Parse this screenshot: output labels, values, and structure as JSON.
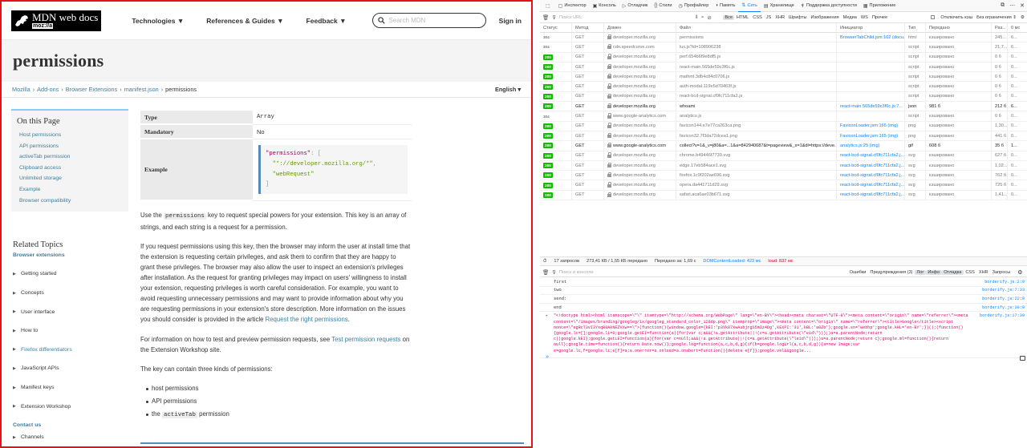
{
  "mdn": {
    "logo": {
      "main": "MDN web docs",
      "sub": "moz://a"
    },
    "nav": [
      "Technologies ▼",
      "References & Guides ▼",
      "Feedback ▼"
    ],
    "search_placeholder": "Search MDN",
    "signin": "Sign in",
    "title": "permissions",
    "breadcrumb": {
      "items": [
        "Mozilla",
        "Add-ons",
        "Browser Extensions",
        "manifest.json"
      ],
      "current": "permissions",
      "separator": "›",
      "language": "English ▾"
    },
    "on_this_page": {
      "heading": "On this Page",
      "links": [
        "Host permissions",
        "API permissions",
        "activeTab permission",
        "Clipboard access",
        "Unlimited storage",
        "Example",
        "Browser compatibility"
      ]
    },
    "related": {
      "heading": "Related Topics",
      "subheading": "Browser extensions",
      "items": [
        {
          "label": "Getting started",
          "link": false
        },
        {
          "label": "Concepts",
          "link": false
        },
        {
          "label": "User interface",
          "link": false
        },
        {
          "label": "How to",
          "link": false
        },
        {
          "label": "Firefox differentiators",
          "link": true
        },
        {
          "label": "JavaScript APIs",
          "link": false
        },
        {
          "label": "Manifest keys",
          "link": false
        },
        {
          "label": "Extension Workshop",
          "link": false
        }
      ],
      "contact": "Contact us",
      "items_after_contact": [
        {
          "label": "Channels",
          "link": false
        }
      ]
    },
    "table": {
      "type_label": "Type",
      "type_value": "Array",
      "mandatory_label": "Mandatory",
      "mandatory_value": "No",
      "example_label": "Example",
      "code": {
        "key": "\"permissions\"",
        "colon_bracket": ": [",
        "line2": "\"*://developer.mozilla.org/*\"",
        "line2_comma": ",",
        "line3": "\"webRequest\"",
        "close": "]"
      }
    },
    "prose": {
      "p1_a": "Use the ",
      "p1_code": "permissions",
      "p1_b": " key to request special powers for your extension. This key is an array of strings, and each string is a request for a permission.",
      "p2_a": "If you request permissions using this key, then the browser may inform the user at install time that the extension is requesting certain privileges, and ask them to confirm that they are happy to grant these privileges. The browser may also allow the user to inspect an extension's privileges after installation. As the request for granting privileges may impact on users' willingness to install your extension, requesting privileges is worth careful consideration. For example, you want to avoid requesting unnecessary permissions and may want to provide information about why you are requesting permissions in your extension's store description. More information on the issues you should consider is provided in the article ",
      "p2_link": "Request the right permissions",
      "p2_b": ".",
      "p3_a": "For information on how to test and preview permission requests, see ",
      "p3_link": "Test permission requests",
      "p3_b": " on the Extension Workshop site.",
      "p4": "The key can contain three kinds of permissions:",
      "list": [
        "host permissions",
        "API permissions"
      ],
      "list3_a": "the ",
      "list3_code": "activeTab",
      "list3_b": " permission"
    },
    "colors": {
      "link": "#3d7e9a",
      "frame": "#e4131b",
      "accent": "#83d0f2"
    }
  },
  "devtools": {
    "tabs": [
      {
        "icon": "▢",
        "label": "Инспектор",
        "active": false
      },
      {
        "icon": "▣",
        "label": "Консоль",
        "active": false
      },
      {
        "icon": "▷",
        "label": "Отладчик",
        "active": false
      },
      {
        "icon": "{}",
        "label": "Стили",
        "active": false
      },
      {
        "icon": "◷",
        "label": "Профайлер",
        "active": false
      },
      {
        "icon": "◑",
        "label": "Память",
        "active": false
      },
      {
        "icon": "⇅",
        "label": "Сеть",
        "active": true
      },
      {
        "icon": "▤",
        "label": "Хранилище",
        "active": false
      },
      {
        "icon": "✝",
        "label": "Поддержка доступности",
        "active": false
      },
      {
        "icon": "▦",
        "label": "Приложение",
        "active": false
      }
    ],
    "filter_placeholder": "Поиск URL",
    "filter_types": [
      "Все",
      "HTML",
      "CSS",
      "JS",
      "XHR",
      "Шрифты",
      "Изображения",
      "Медиа",
      "WS",
      "Прочее"
    ],
    "filter_active": "Все",
    "opts": {
      "cache": "Отключить кэш",
      "throttle": "Без ограничения ⇕"
    },
    "columns": [
      "Статус",
      "Метод",
      "Домен",
      "Файл",
      "Инициатор",
      "Тип",
      "Передано",
      "Раз...",
      "0 мс"
    ],
    "rows": [
      {
        "status": "304",
        "method": "GET",
        "domain": "developer.mozilla.org",
        "file": "permissions",
        "initiator": "BrowserTabChild.jsm:102 (docu...",
        "type": "html",
        "transferred": "кэшировано",
        "size": "245...",
        "time": "6...",
        "ok": false,
        "dark": false,
        "lock": true
      },
      {
        "status": "304",
        "method": "GET",
        "domain": "cdn.speedcurve.com",
        "file": "lux.js?id=108906238",
        "initiator": "",
        "type": "script",
        "transferred": "кэшировано",
        "size": "21,7...",
        "time": "6...",
        "ok": false,
        "dark": false,
        "lock": true
      },
      {
        "status": "200",
        "method": "GET",
        "domain": "developer.mozilla.org",
        "file": "perf.654b6f9e8df5.js",
        "initiator": "",
        "type": "script",
        "transferred": "кэшировано",
        "size": "0 б",
        "time": "0...",
        "ok": true,
        "dark": false,
        "lock": true
      },
      {
        "status": "200",
        "method": "GET",
        "domain": "developer.mozilla.org",
        "file": "react-main.565de59c3f6c.js",
        "initiator": "",
        "type": "script",
        "transferred": "кэшировано",
        "size": "0 б",
        "time": "0...",
        "ok": true,
        "dark": false,
        "lock": true
      },
      {
        "status": "200",
        "method": "GET",
        "domain": "developer.mozilla.org",
        "file": "mathml.3db4c84c0706.js",
        "initiator": "",
        "type": "script",
        "transferred": "кэшировано",
        "size": "0 б",
        "time": "0...",
        "ok": true,
        "dark": false,
        "lock": true
      },
      {
        "status": "200",
        "method": "GET",
        "domain": "developer.mozilla.org",
        "file": "auth-modal.119e5d70463f.js",
        "initiator": "",
        "type": "script",
        "transferred": "кэшировано",
        "size": "0 б",
        "time": "0...",
        "ok": true,
        "dark": false,
        "lock": true
      },
      {
        "status": "200",
        "method": "GET",
        "domain": "developer.mozilla.org",
        "file": "react-bcd-signal.cf0fc711cfa2.js",
        "initiator": "",
        "type": "script",
        "transferred": "кэшировано",
        "size": "0 б",
        "time": "0...",
        "ok": true,
        "dark": false,
        "lock": true
      },
      {
        "status": "200",
        "method": "GET",
        "domain": "developer.mozilla.org",
        "file": "whoami",
        "initiator": "react-main.565de59c3f6c.js:7...",
        "type": "json",
        "transferred": "981 б",
        "size": "212 б",
        "time": "6...",
        "ok": true,
        "dark": true,
        "lock": true
      },
      {
        "status": "304",
        "method": "GET",
        "domain": "www.google-analytics.com",
        "file": "analytics.js",
        "initiator": "",
        "type": "script",
        "transferred": "кэшировано",
        "size": "0 б",
        "time": "0...",
        "ok": false,
        "dark": false,
        "lock": true
      },
      {
        "status": "200",
        "method": "GET",
        "domain": "developer.mozilla.org",
        "file": "favicon144.e7e77ca263ca.png",
        "initiator": "FaviconLoader.jsm:165 (img)",
        "type": "png",
        "transferred": "кэшировано",
        "size": "1,30...",
        "time": "0...",
        "ok": true,
        "dark": false,
        "lock": true
      },
      {
        "status": "200",
        "method": "GET",
        "domain": "developer.mozilla.org",
        "file": "favicon32.7f3da72dcea1.png",
        "initiator": "FaviconLoader.jsm:165 (img)",
        "type": "png",
        "transferred": "кэшировано",
        "size": "441 б",
        "time": "0...",
        "ok": true,
        "dark": false,
        "lock": true
      },
      {
        "status": "200",
        "method": "GET",
        "domain": "www.google-analytics.com",
        "file": "collect?v=1&_v=j80&a=...1&a=842940687&t=pageview&_s=1&dl=https://deve...",
        "initiator": "analytics.js:25 (img)",
        "type": "gif",
        "transferred": "608 б",
        "size": "35 б",
        "time": "1...",
        "ok": true,
        "dark": true,
        "lock": true
      },
      {
        "status": "200",
        "method": "GET",
        "domain": "developer.mozilla.org",
        "file": "chrome.b49446f7739.svg",
        "initiator": "react-bcd-signal.cf0fc711cfa2.j...",
        "type": "svg",
        "transferred": "кэшировано",
        "size": "627 б",
        "time": "0...",
        "ok": true,
        "dark": false,
        "lock": true
      },
      {
        "status": "200",
        "method": "GET",
        "domain": "developer.mozilla.org",
        "file": "edge.17eb584ace1.svg",
        "initiator": "react-bcd-signal.cf0fc711cfa2.j...",
        "type": "svg",
        "transferred": "кэшировано",
        "size": "1,02...",
        "time": "0...",
        "ok": true,
        "dark": false,
        "lock": true
      },
      {
        "status": "200",
        "method": "GET",
        "domain": "developer.mozilla.org",
        "file": "firefox.1c9f202ae696.svg",
        "initiator": "react-bcd-signal.cf0fc711cfa2.j...",
        "type": "svg",
        "transferred": "кэшировано",
        "size": "762 б",
        "time": "0...",
        "ok": true,
        "dark": false,
        "lock": true
      },
      {
        "status": "200",
        "method": "GET",
        "domain": "developer.mozilla.org",
        "file": "opera.da441711d29.svg",
        "initiator": "react-bcd-signal.cf0fc711cfa2.j...",
        "type": "svg",
        "transferred": "кэшировано",
        "size": "725 б",
        "time": "0...",
        "ok": true,
        "dark": false,
        "lock": true
      },
      {
        "status": "200",
        "method": "GET",
        "domain": "developer.mozilla.org",
        "file": "safari.aca6ae03b671.svg",
        "initiator": "react-bcd-signal.cf0fc711cfa2.j...",
        "type": "svg",
        "transferred": "кэшировано",
        "size": "1,41...",
        "time": "0...",
        "ok": true,
        "dark": false,
        "lock": true
      }
    ],
    "summary": {
      "requests": "17 запросов",
      "size": "273,41 КБ / 1,55 КБ передано",
      "finish": "Передано за: 1,69 с",
      "dom": "DOMContentLoaded: 423 мс",
      "load": "load: 837 мс"
    },
    "console": {
      "filter_placeholder": "Поиск в консоли",
      "filters": [
        "Ошибки",
        "Предупреждения (3)",
        "Лог",
        "Инфо",
        "Отладка",
        "CSS",
        "XHR",
        "Запросы"
      ],
      "active_filters": [
        "Лог",
        "Инфо",
        "Отладка"
      ],
      "lines": [
        {
          "text": "first",
          "src": "borderify.js:2:9"
        },
        {
          "text": "two",
          "src": "borderify.js:7:33"
        },
        {
          "text": "send:",
          "src": "borderify.js:22:9"
        },
        {
          "text": "end",
          "src": "borderify.js:30:9"
        }
      ],
      "html_dump": "\"<!doctype html><html itemscope=\\\"\\\" itemtype=\\\"http://schema.org/WebPage\\\" lang=\\\"en-BY\\\"><head><meta charset=\\\"UTF-8\\\"><meta content=\\\"origin\\\" name=\\\"referrer\\\"><meta content=\\\"/images/branding/googleg/1x/googleg_standard_color_128dp.png\\\" itemprop=\\\"image\\\"><meta content=\\\"origin\\\" name=\\\"referrer\\\"><title>Google</title><script nonce=\\\"egRcT3vI3YsqB0AkNEZVXw==\\\">(function(){window.google={kEI:'p3Yk87XwAubjrgS5mIz4Dg',kEXPI:'31',kBL:'a0Zb'};google.sn='webhp';google.kHL='en-BY';})();(function(){google.lc=[];google.li=0;google.getEI=function(a){for(var c;a&&(!a.getAttribute||!(c=a.getAttribute(\\\"eid\\\")));)a=a.parentNode;return c||google.kEI};google.getLEI=function(a){for(var c=null;a&&(!a.getAttribute||!(c=a.getAttribute(\\\"leid\\\")));)a=a.parentNode;return c};google.ml=function(){return null};google.time=function(){return Date.now()};google.log=function(a,c,b,d,g){if(b=google.logUrl(a,c,b,d,g)){a=new Image;var e=google.lc,f=google.li;e[f]=a;a.onerror=a.onload=a.onabort=function(){delete e[f]};google.vel&&google...",
      "html_src": "borderify.js:17:39",
      "prompt": "»"
    }
  }
}
